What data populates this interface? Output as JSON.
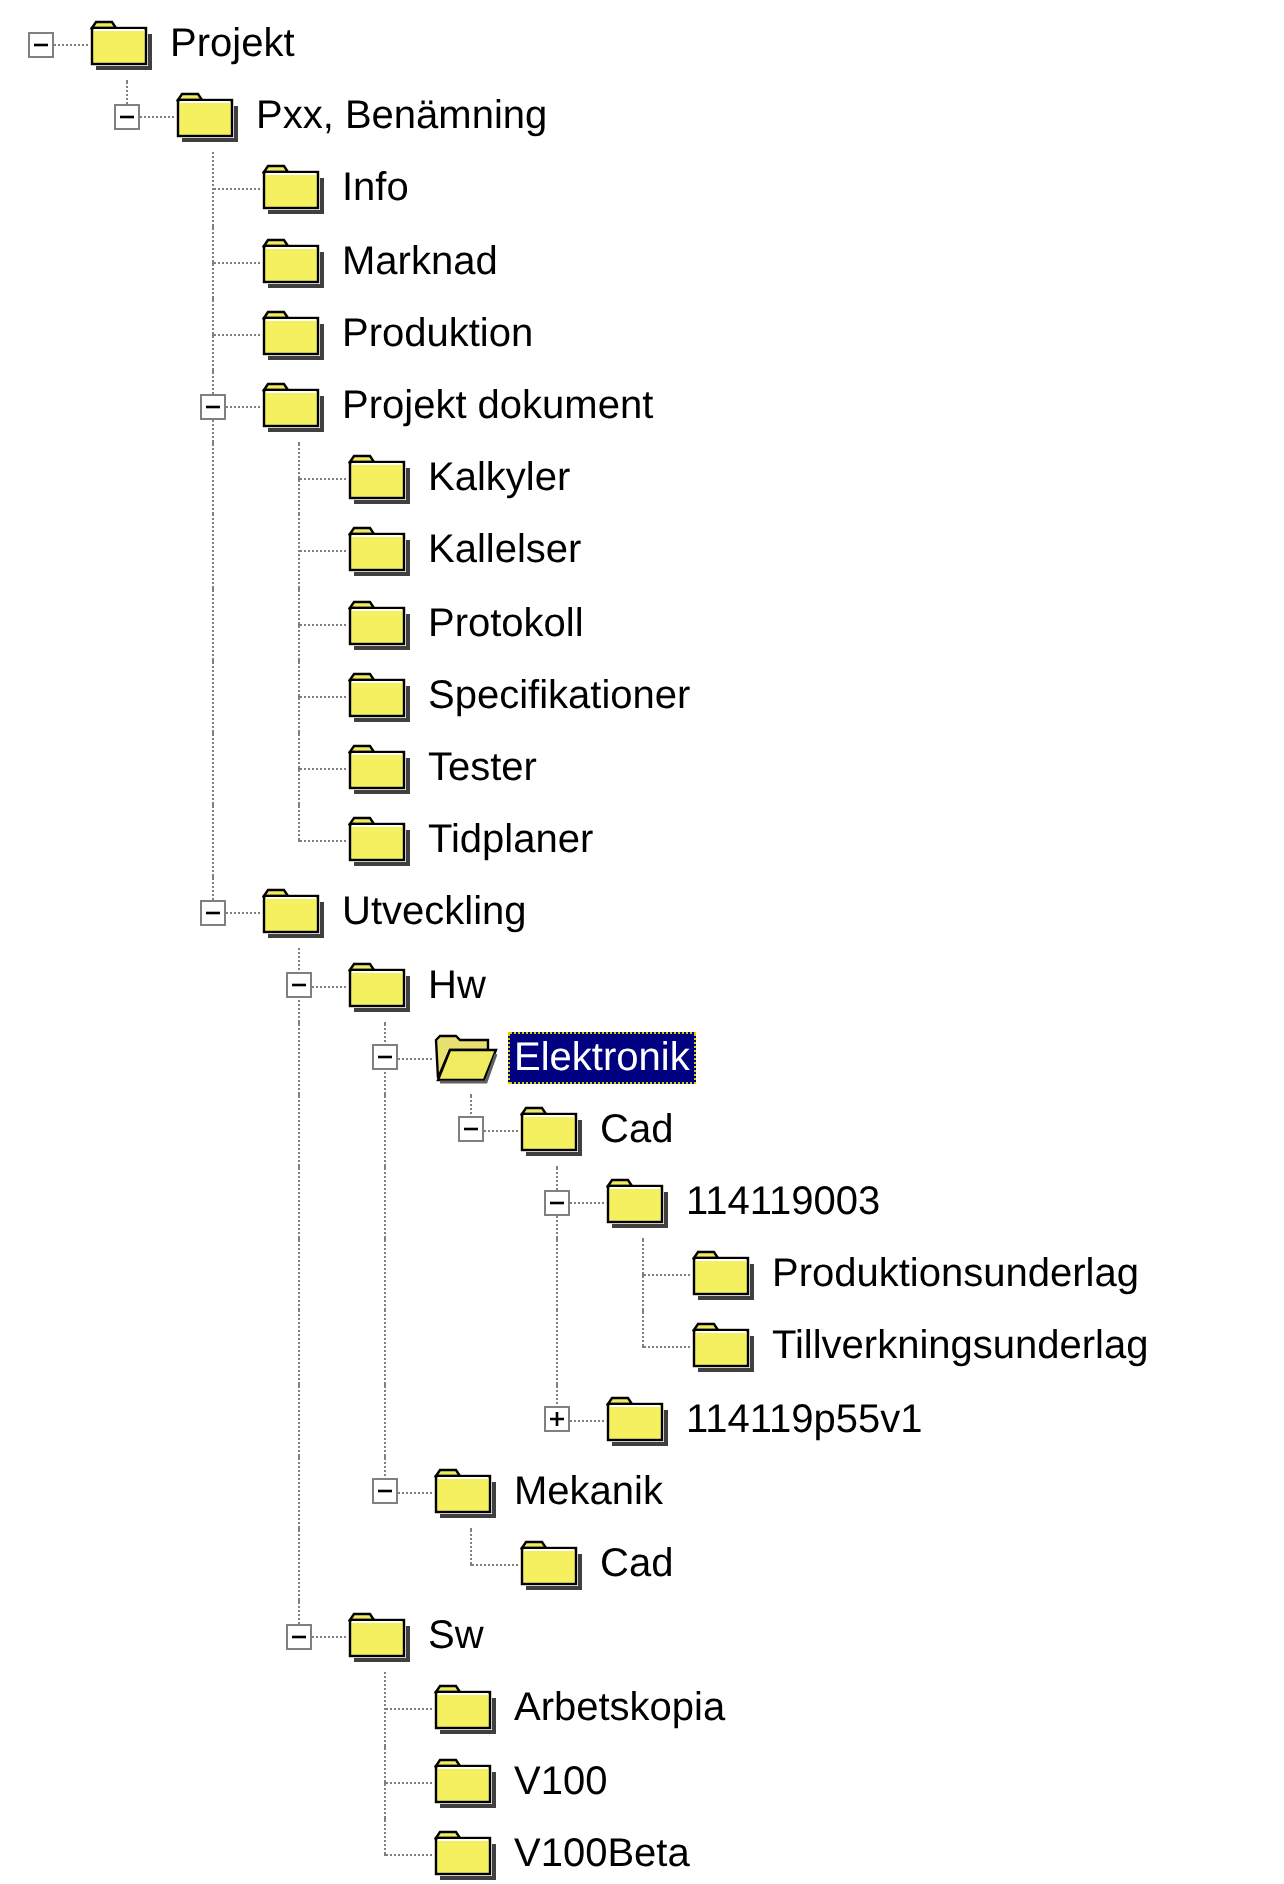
{
  "tree": [
    {
      "label": "Projekt",
      "selected": false,
      "expanded": true,
      "children": [
        {
          "label": "Pxx, Benämning",
          "selected": false,
          "expanded": true,
          "children": [
            {
              "label": "Info",
              "selected": false
            },
            {
              "label": "Marknad",
              "selected": false
            },
            {
              "label": "Produktion",
              "selected": false
            },
            {
              "label": "Projekt dokument",
              "selected": false,
              "expanded": true,
              "children": [
                {
                  "label": "Kalkyler",
                  "selected": false
                },
                {
                  "label": "Kallelser",
                  "selected": false
                },
                {
                  "label": "Protokoll",
                  "selected": false
                },
                {
                  "label": "Specifikationer",
                  "selected": false
                },
                {
                  "label": "Tester",
                  "selected": false
                },
                {
                  "label": "Tidplaner",
                  "selected": false
                }
              ]
            },
            {
              "label": "Utveckling",
              "selected": false,
              "expanded": true,
              "children": [
                {
                  "label": "Hw",
                  "selected": false,
                  "expanded": true,
                  "children": [
                    {
                      "label": "Elektronik",
                      "selected": true,
                      "expanded": true,
                      "children": [
                        {
                          "label": "Cad",
                          "selected": false,
                          "expanded": true,
                          "children": [
                            {
                              "label": "114119003",
                              "selected": false,
                              "expanded": true,
                              "children": [
                                {
                                  "label": "Produktionsunderlag",
                                  "selected": false
                                },
                                {
                                  "label": "Tillverkningsunderlag",
                                  "selected": false
                                }
                              ]
                            },
                            {
                              "label": "114119p55v1",
                              "selected": false,
                              "expanded": false
                            }
                          ]
                        }
                      ]
                    },
                    {
                      "label": "Mekanik",
                      "selected": false,
                      "expanded": true,
                      "children": [
                        {
                          "label": "Cad",
                          "selected": false
                        }
                      ]
                    }
                  ]
                },
                {
                  "label": "Sw",
                  "selected": false,
                  "expanded": true,
                  "children": [
                    {
                      "label": "Arbetskopia",
                      "selected": false
                    },
                    {
                      "label": "V100",
                      "selected": false
                    },
                    {
                      "label": "V100Beta",
                      "selected": false
                    }
                  ]
                }
              ]
            }
          ]
        }
      ]
    }
  ]
}
